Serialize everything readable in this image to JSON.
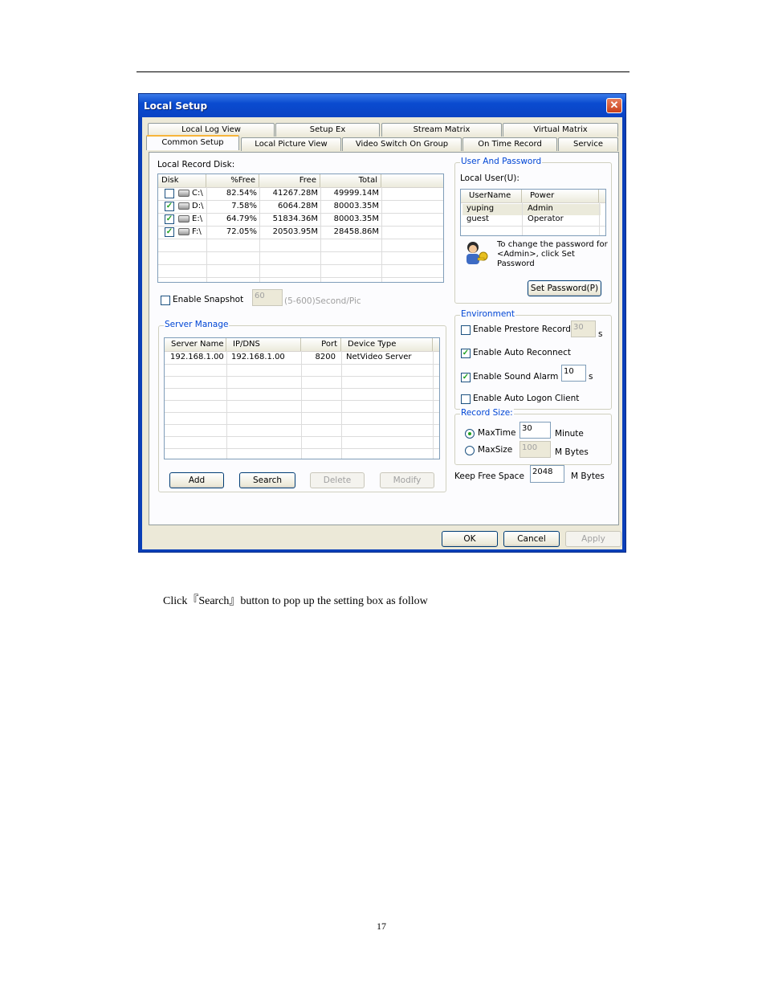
{
  "window": {
    "title": "Local Setup",
    "close_glyph": "✕"
  },
  "tabs_row1": [
    "Local Log View",
    "Setup Ex",
    "Stream Matrix",
    "Virtual Matrix"
  ],
  "tabs_row2": [
    "Common Setup",
    "Local Picture View",
    "Video Switch On Group",
    "On Time Record",
    "Service"
  ],
  "record_disk": {
    "label": "Local Record Disk:",
    "columns": [
      "Disk",
      "%Free",
      "Free",
      "Total"
    ],
    "rows": [
      {
        "checked": false,
        "disk": "C:\\",
        "pfree": "82.54%",
        "free": "41267.28M",
        "total": "49999.14M"
      },
      {
        "checked": true,
        "disk": "D:\\",
        "pfree": "7.58%",
        "free": "6064.28M",
        "total": "80003.35M"
      },
      {
        "checked": true,
        "disk": "E:\\",
        "pfree": "64.79%",
        "free": "51834.36M",
        "total": "80003.35M"
      },
      {
        "checked": true,
        "disk": "F:\\",
        "pfree": "72.05%",
        "free": "20503.95M",
        "total": "28458.86M"
      }
    ]
  },
  "snapshot": {
    "label": "Enable Snapshot",
    "value": "60",
    "hint": "(5-600)Second/Pic",
    "checked": false
  },
  "server_manage": {
    "title": "Server Manage",
    "columns": [
      "Server Name",
      "IP/DNS",
      "Port",
      "Device Type"
    ],
    "rows": [
      {
        "name": "192.168.1.00",
        "ip": "192.168.1.00",
        "port": "8200",
        "type": "NetVideo Server"
      }
    ],
    "buttons": {
      "add": "Add",
      "search": "Search",
      "delete": "Delete",
      "modify": "Modify"
    }
  },
  "user_password": {
    "title": "User And Password",
    "local_user_label": "Local User(U):",
    "columns": [
      "UserName",
      "Power"
    ],
    "rows": [
      {
        "user": "yuping",
        "power": "Admin"
      },
      {
        "user": "guest",
        "power": "Operator"
      }
    ],
    "note": [
      "To change the password for",
      "<Admin>, click Set",
      "Password"
    ],
    "set_password": "Set Password(P)"
  },
  "environment": {
    "title": "Environment",
    "prestore": {
      "label": "Enable Prestore Record",
      "value": "30",
      "unit": "s",
      "checked": false
    },
    "auto_reconnect": {
      "label": "Enable Auto Reconnect",
      "checked": true
    },
    "sound_alarm": {
      "label": "Enable Sound Alarm",
      "value": "10",
      "unit": "s",
      "checked": true
    },
    "auto_logon": {
      "label": "Enable Auto Logon Client",
      "checked": false
    }
  },
  "record_size": {
    "title": "Record Size:",
    "maxtime": {
      "label": "MaxTime",
      "value": "30",
      "unit": "Minute",
      "selected": true
    },
    "maxsize": {
      "label": "MaxSize",
      "value": "100",
      "unit": "M Bytes",
      "selected": false
    }
  },
  "keep_free": {
    "label": "Keep Free Space",
    "value": "2048",
    "unit": "M Bytes"
  },
  "footer_buttons": {
    "ok": "OK",
    "cancel": "Cancel",
    "apply": "Apply"
  },
  "caption": "Click『Search』button to pop up the setting box as follow",
  "page_number": "17"
}
